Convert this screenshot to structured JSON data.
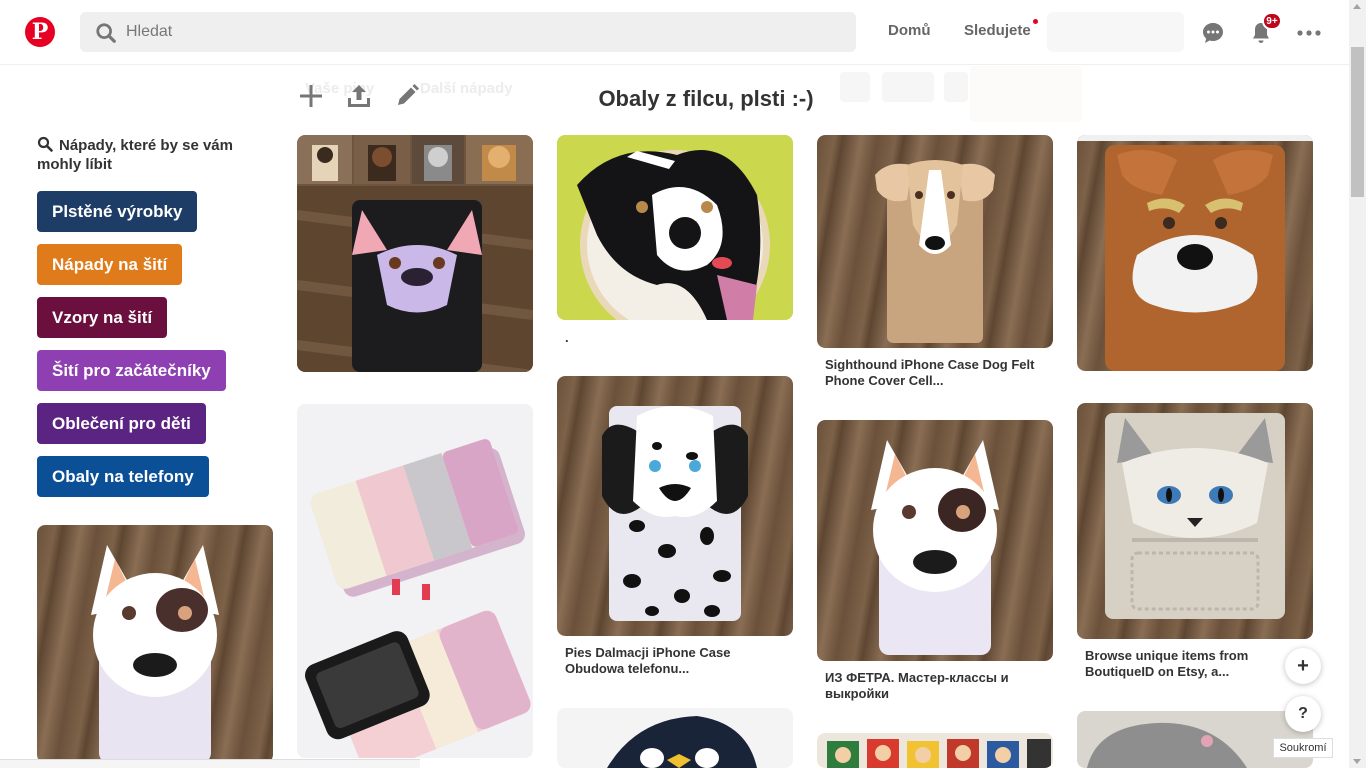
{
  "header": {
    "logo": "P",
    "search_placeholder": "Hledat",
    "nav_home": "Domů",
    "nav_following": "Sledujete",
    "notification_badge": "9+",
    "icons": [
      "pinterest-logo",
      "search-icon",
      "chat-icon",
      "bell-icon",
      "more-icon"
    ]
  },
  "board": {
    "title": "Obaly z filcu, plsti :-)",
    "ghost_tab_1": "Vaše piny",
    "ghost_tab_2": "Další nápady",
    "tools": [
      "add-icon",
      "upload-icon",
      "edit-icon"
    ]
  },
  "sidebar": {
    "ideas_heading": "Nápady, které by se vám mohly líbit",
    "tags": [
      {
        "label": "Plstěné výrobky",
        "color": "#1e3d66"
      },
      {
        "label": "Nápady na šití",
        "color": "#e07b1b"
      },
      {
        "label": "Vzory na šití",
        "color": "#6b0f3e"
      },
      {
        "label": "Šití pro začátečníky",
        "color": "#8e3fb2"
      },
      {
        "label": "Oblečení pro děti",
        "color": "#5c2482"
      },
      {
        "label": "Obaly na telefony",
        "color": "#0b4f96"
      }
    ]
  },
  "pins": [
    {
      "caption": ""
    },
    {
      "caption": "."
    },
    {
      "caption": "Sighthound iPhone Case Dog Felt Phone Cover Cell..."
    },
    {
      "caption": ""
    },
    {
      "caption": ""
    },
    {
      "caption": "Pies Dalmacji iPhone Case Obudowa telefonu..."
    },
    {
      "caption": "ИЗ ФЕТРА. Мастер-классы и выкройки"
    },
    {
      "caption": "Browse unique items from BoutiqueID on Etsy, a..."
    }
  ],
  "floating": {
    "add": "+",
    "help": "?",
    "tooltip": "Soukromí"
  }
}
